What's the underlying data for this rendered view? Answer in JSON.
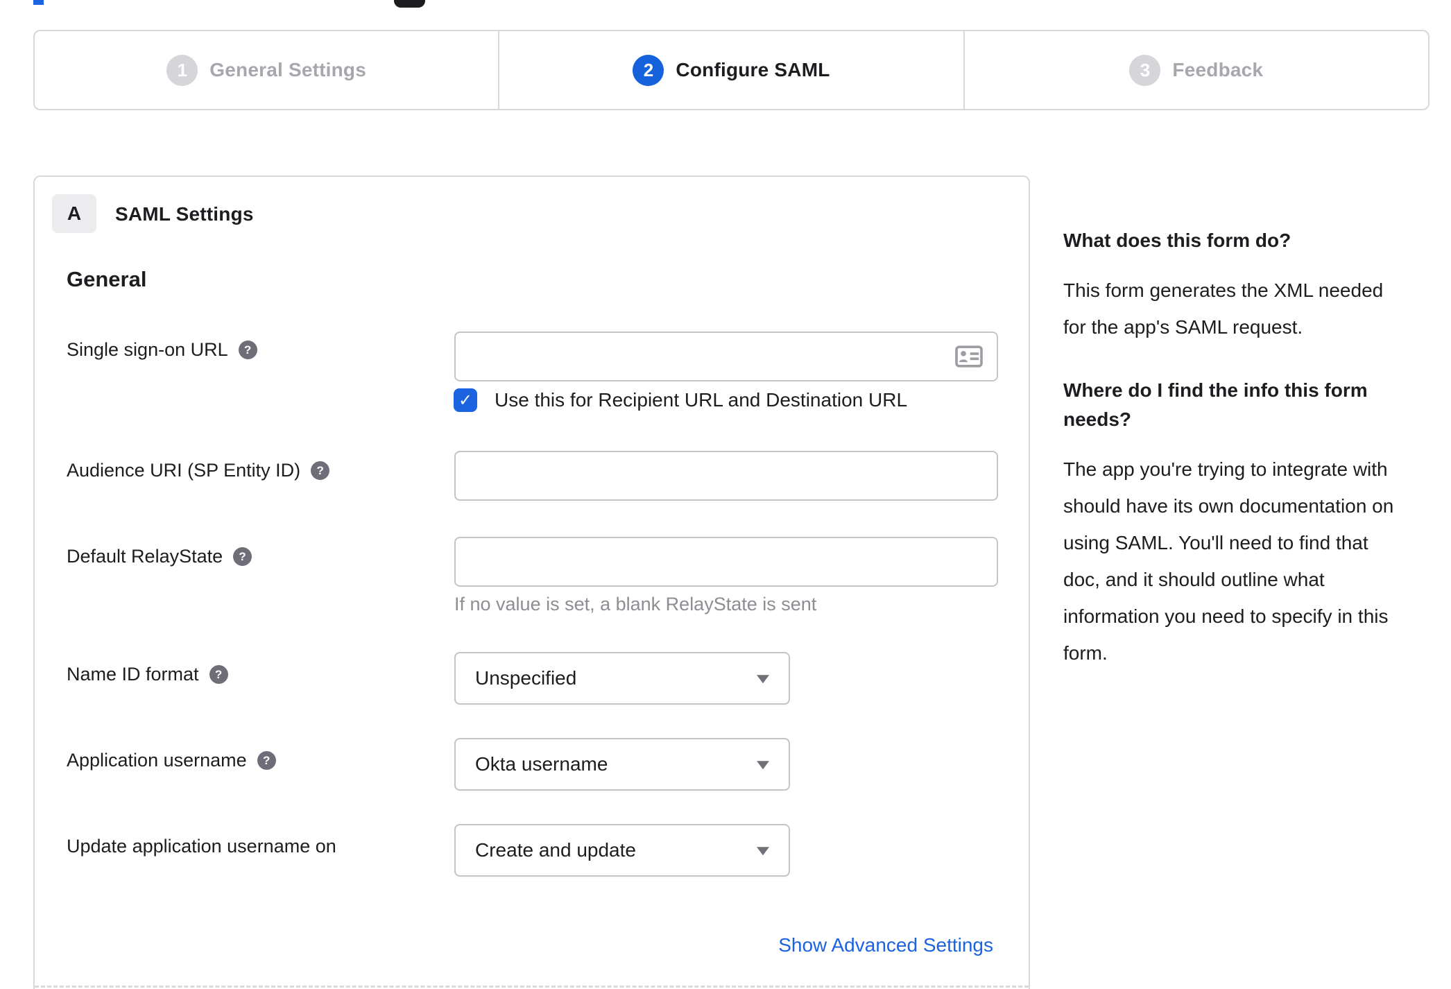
{
  "stepper": {
    "steps": [
      {
        "number": "1",
        "label": "General Settings",
        "state": "inactive"
      },
      {
        "number": "2",
        "label": "Configure SAML",
        "state": "active"
      },
      {
        "number": "3",
        "label": "Feedback",
        "state": "inactive"
      }
    ]
  },
  "form": {
    "section_badge": "A",
    "section_title": "SAML Settings",
    "group_heading": "General",
    "sso": {
      "label": "Single sign-on URL",
      "value": "",
      "checkbox_checked": true,
      "checkbox_label": "Use this for Recipient URL and Destination URL"
    },
    "audience": {
      "label": "Audience URI (SP Entity ID)",
      "value": ""
    },
    "relay_state": {
      "label": "Default RelayState",
      "value": "",
      "hint": "If no value is set, a blank RelayState is sent"
    },
    "name_id_format": {
      "label": "Name ID format",
      "value": "Unspecified"
    },
    "app_username": {
      "label": "Application username",
      "value": "Okta username"
    },
    "update_app_username": {
      "label": "Update application username on",
      "value": "Create and update"
    },
    "advanced_link": "Show Advanced Settings"
  },
  "sidebar": {
    "q1_title": "What does this form do?",
    "q1_body": "This form generates the XML needed\nfor the app's SAML request.",
    "q2_title": "Where do I find the info this form\nneeds?",
    "q2_body": "The app you're trying to integrate with\nshould have its own documentation on\nusing SAML. You'll need to find that\ndoc, and it should outline what\ninformation you need to specify in this\nform."
  },
  "icons": {
    "help": "?",
    "check": "✓"
  },
  "colors": {
    "accent_blue": "#1662dd",
    "checkbox_blue": "#1b63e0",
    "inactive_gray": "#a7a7ad",
    "border_gray": "#d8d8dc",
    "text": "#1d1d21"
  }
}
